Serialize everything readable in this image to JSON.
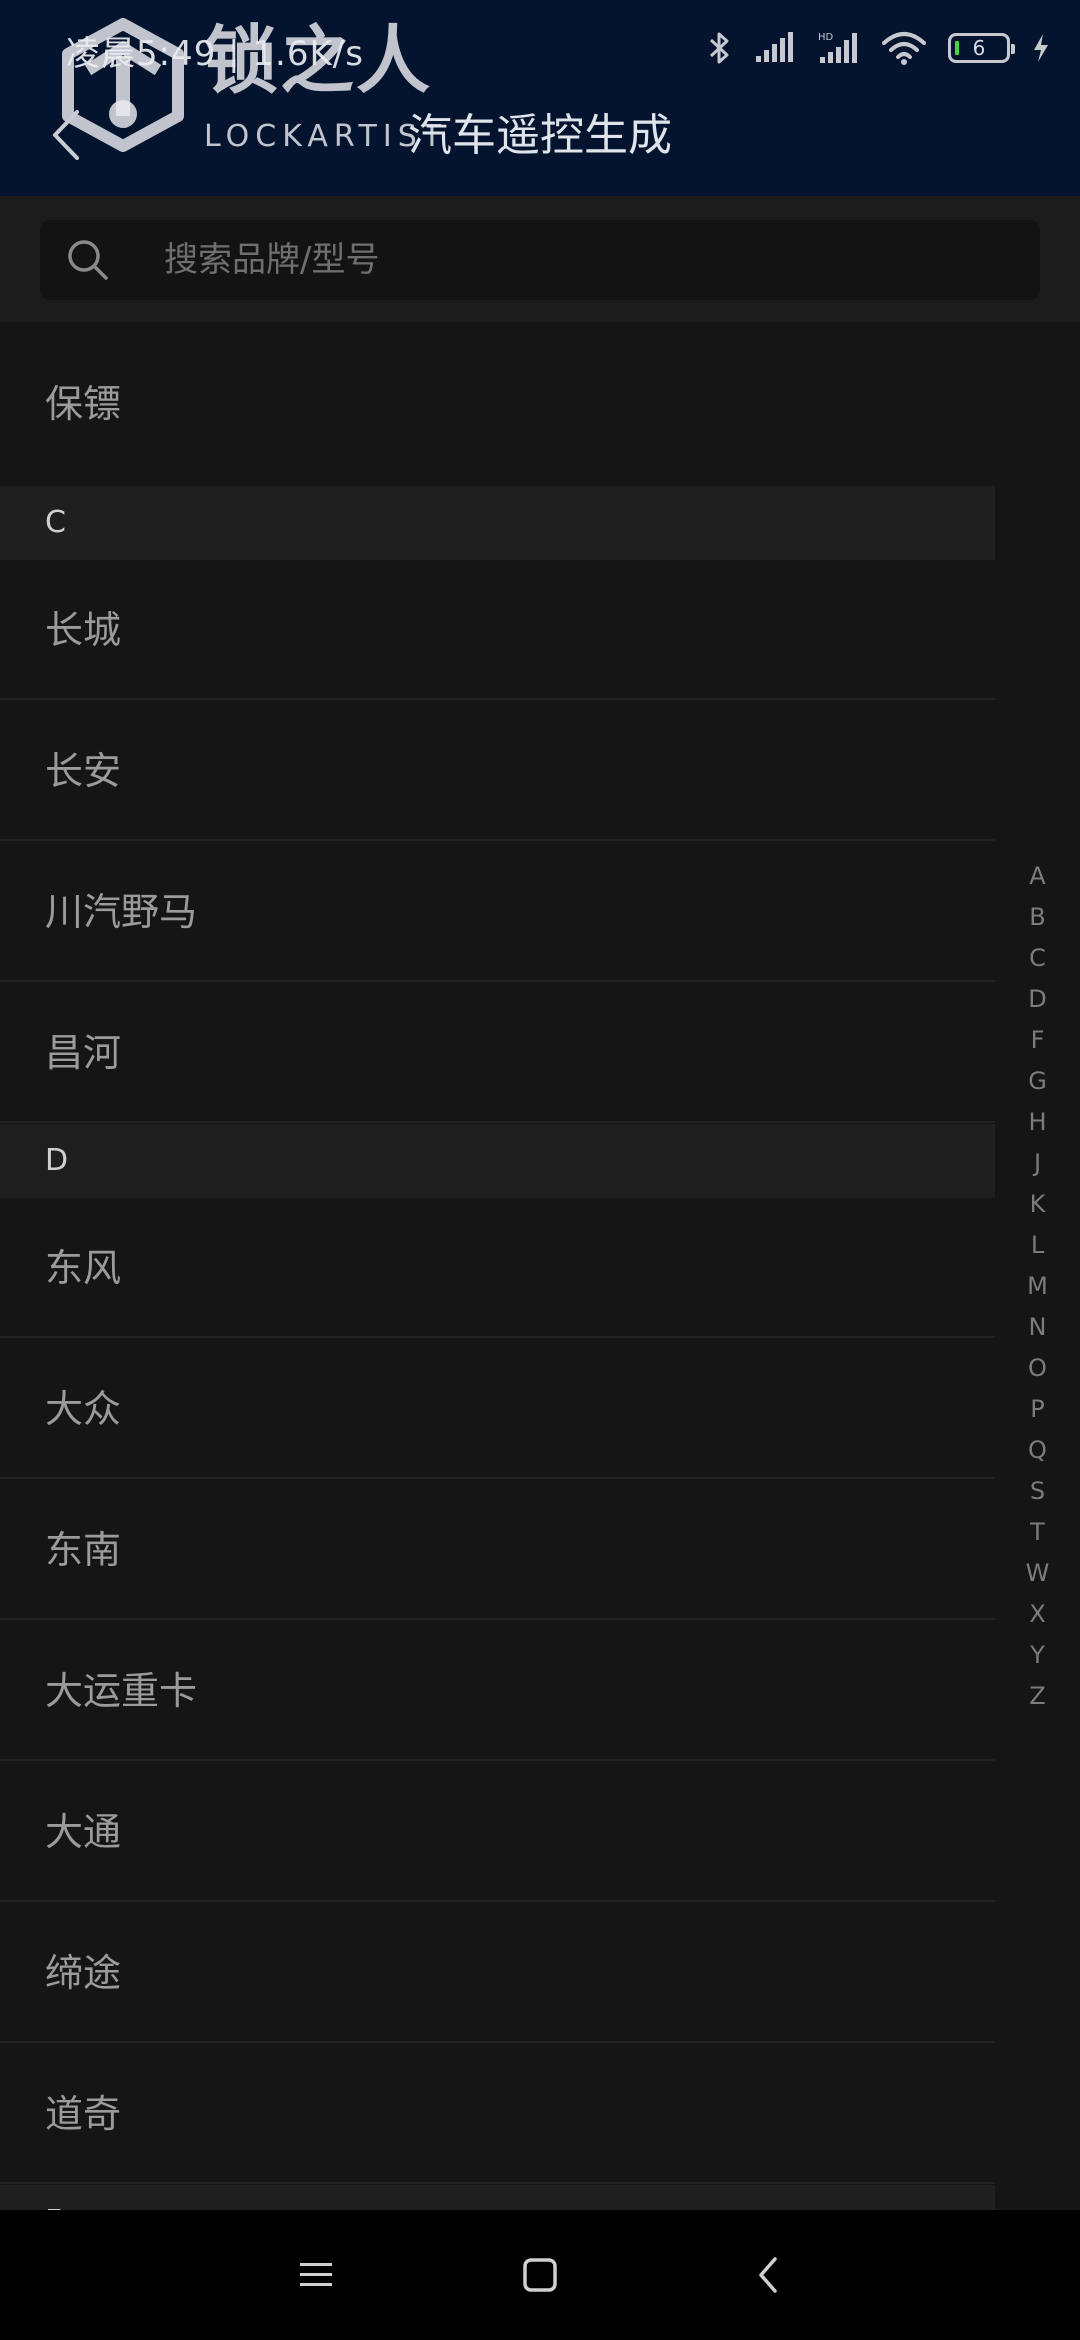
{
  "status_bar": {
    "time": "凌晨5:49 | 1.6K/s",
    "battery_level": "6"
  },
  "watermark": {
    "text_cn": "锁之人",
    "text_en": "LOCKARTIST"
  },
  "header": {
    "title": "汽车遥控生成"
  },
  "search": {
    "placeholder": "搜索品牌/型号",
    "value": ""
  },
  "list": {
    "brands": [
      {
        "kind": "item",
        "label": "保镖"
      },
      {
        "kind": "section",
        "label": "C"
      },
      {
        "kind": "item",
        "label": "长城"
      },
      {
        "kind": "item",
        "label": "长安"
      },
      {
        "kind": "item",
        "label": "川汽野马"
      },
      {
        "kind": "item",
        "label": "昌河"
      },
      {
        "kind": "section",
        "label": "D"
      },
      {
        "kind": "item",
        "label": "东风"
      },
      {
        "kind": "item",
        "label": "大众"
      },
      {
        "kind": "item",
        "label": "东南"
      },
      {
        "kind": "item",
        "label": "大运重卡"
      },
      {
        "kind": "item",
        "label": "大通"
      },
      {
        "kind": "item",
        "label": "缔途"
      },
      {
        "kind": "item",
        "label": "道奇"
      },
      {
        "kind": "section",
        "label": "F"
      }
    ]
  },
  "index_bar": {
    "letters": [
      "A",
      "B",
      "C",
      "D",
      "F",
      "G",
      "H",
      "J",
      "K",
      "L",
      "M",
      "N",
      "O",
      "P",
      "Q",
      "S",
      "T",
      "W",
      "X",
      "Y",
      "Z"
    ]
  },
  "colors": {
    "header_bg": "#04142e",
    "page_bg": "#151515",
    "section_bg": "#1f1f1f",
    "nav_bg": "#000000"
  }
}
